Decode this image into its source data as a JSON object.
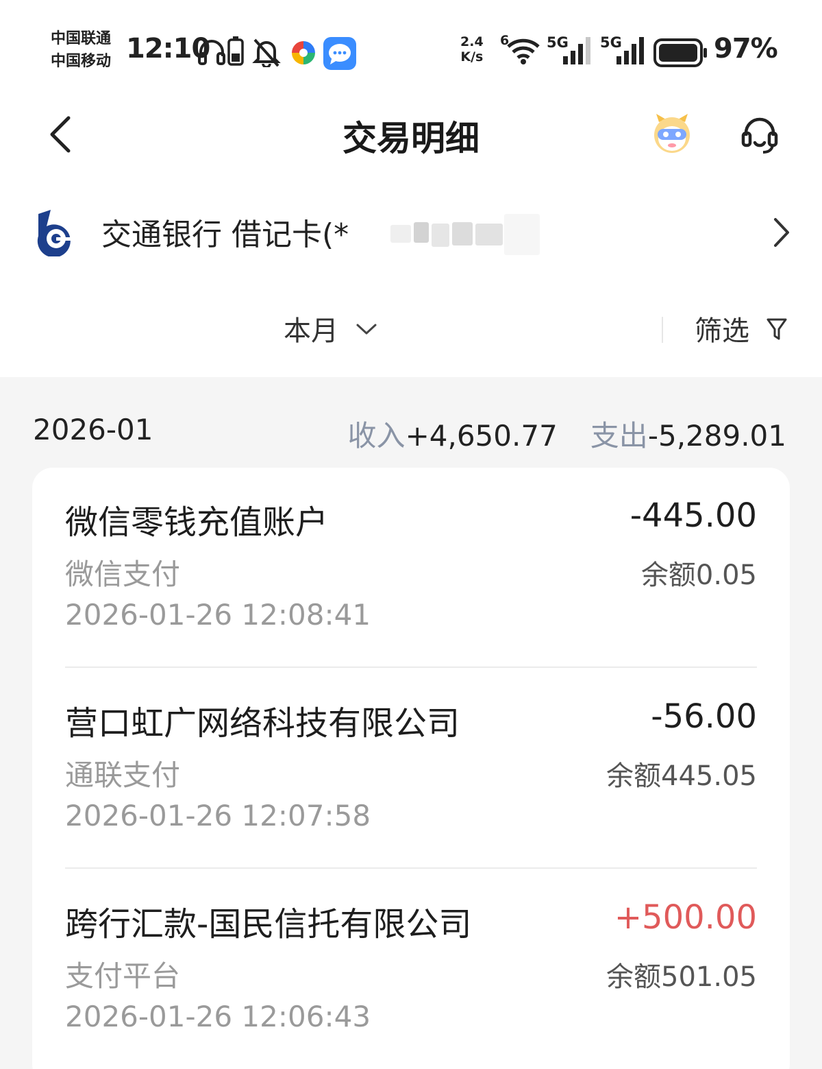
{
  "status_bar": {
    "carrier_1": "中国联通",
    "carrier_2": "中国移动",
    "time": "12:10",
    "net_speed_value": "2.4",
    "net_speed_unit": "K/s",
    "wifi_badge": "6",
    "signal_1": "5G",
    "signal_2": "5G",
    "battery": "97%",
    "icons": [
      "headphones-icon",
      "battery-small-icon",
      "mute-bell-icon",
      "app-pinwheel-icon",
      "message-app-icon",
      "wifi-icon",
      "signal-icon",
      "battery-icon"
    ]
  },
  "header": {
    "title": "交易明细",
    "back_icon": "chevron-left-icon",
    "mascot_icon": "mascot-avatar-icon",
    "service_icon": "headset-icon"
  },
  "account": {
    "label": "交通银行 借记卡(*",
    "logo_icon": "bocom-logo-icon",
    "chevron_icon": "chevron-right-icon"
  },
  "filters": {
    "period": "本月",
    "filter": "筛选",
    "period_icon": "chevron-down-icon",
    "filter_icon": "funnel-icon"
  },
  "summary": {
    "month": "2026-01",
    "income_label": "收入",
    "income_value": "+4,650.77",
    "expense_label": "支出",
    "expense_value": "-5,289.01"
  },
  "colors": {
    "credit": "#e05a5a",
    "muted_label": "#8a94a6",
    "background": "#f5f5f5"
  },
  "transactions": [
    {
      "name": "微信零钱充值账户",
      "channel": "微信支付",
      "time": "2026-01-26 12:08:41",
      "amount": "-445.00",
      "balance": "余额0.05"
    },
    {
      "name": "营口虹广网络科技有限公司",
      "channel": "通联支付",
      "time": "2026-01-26 12:07:58",
      "amount": "-56.00",
      "balance": "余额445.05"
    },
    {
      "name": "跨行汇款-国民信托有限公司",
      "channel": "支付平台",
      "time": "2026-01-26 12:06:43",
      "amount": "+500.00",
      "balance": "余额501.05"
    }
  ]
}
